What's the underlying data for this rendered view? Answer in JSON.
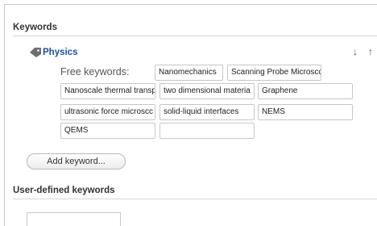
{
  "keywords_section": {
    "title": "Keywords"
  },
  "category": {
    "name": "Physics",
    "icon": "tag-icon",
    "down_arrow": "↓",
    "up_arrow": "↑"
  },
  "free_keywords": {
    "label": "Free keywords:",
    "fields": [
      "Nanomechanics",
      "Scanning Probe Microscc",
      "Nanoscale thermal transp",
      "two dimensional materia",
      "Graphene",
      "ultrasonic force microscc",
      "solid-liquid interfaces",
      "NEMS",
      "QEMS",
      ""
    ]
  },
  "add_keyword_button": "Add keyword...",
  "user_defined_section": {
    "title": "User-defined keywords",
    "field_value": ""
  }
}
